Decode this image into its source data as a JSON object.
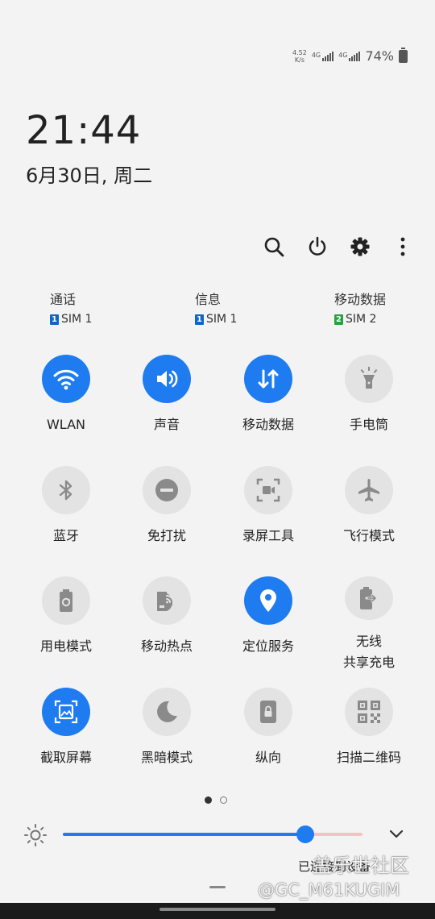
{
  "status_bar": {
    "net_speed_value": "4.52",
    "net_speed_unit": "K/s",
    "sim1_label": "4G",
    "sim2_label": "4G",
    "battery_percent": "74%"
  },
  "clock": {
    "time": "21:44",
    "date": "6月30日, 周二"
  },
  "top_actions": [
    {
      "icon": "search-icon"
    },
    {
      "icon": "power-icon"
    },
    {
      "icon": "gear-icon"
    },
    {
      "icon": "more-vertical-icon"
    }
  ],
  "sim_prefs": [
    {
      "title": "通话",
      "sim_num": "1",
      "sim_name": "SIM 1",
      "color": "#1565c0"
    },
    {
      "title": "信息",
      "sim_num": "1",
      "sim_name": "SIM 1",
      "color": "#1565c0"
    },
    {
      "title": "移动数据",
      "sim_num": "2",
      "sim_name": "SIM 2",
      "color": "#2e9e3f"
    }
  ],
  "tiles": [
    {
      "label": "WLAN",
      "icon": "wifi-icon",
      "on": true
    },
    {
      "label": "声音",
      "icon": "volume-icon",
      "on": true
    },
    {
      "label": "移动数据",
      "icon": "mobile-data-icon",
      "on": true
    },
    {
      "label": "手电筒",
      "icon": "flashlight-icon",
      "on": false
    },
    {
      "label": "蓝牙",
      "icon": "bluetooth-icon",
      "on": false
    },
    {
      "label": "免打扰",
      "icon": "do-not-disturb-icon",
      "on": false
    },
    {
      "label": "录屏工具",
      "icon": "screen-recorder-icon",
      "on": false
    },
    {
      "label": "飞行模式",
      "icon": "airplane-icon",
      "on": false
    },
    {
      "label": "用电模式",
      "icon": "power-mode-icon",
      "on": false
    },
    {
      "label": "移动热点",
      "icon": "hotspot-icon",
      "on": false
    },
    {
      "label": "定位服务",
      "icon": "location-icon",
      "on": true
    },
    {
      "label": "无线\n共享充电",
      "icon": "wireless-powershare-icon",
      "on": false
    },
    {
      "label": "截取屏幕",
      "icon": "screenshot-icon",
      "on": true
    },
    {
      "label": "黑暗模式",
      "icon": "dark-mode-icon",
      "on": false
    },
    {
      "label": "纵向",
      "icon": "portrait-lock-icon",
      "on": false
    },
    {
      "label": "扫描二维码",
      "icon": "qr-scan-icon",
      "on": false
    }
  ],
  "pager": {
    "pages": 2,
    "active": 0
  },
  "brightness": {
    "level": 0.81,
    "icon": "sun-icon",
    "expand_icon": "chevron-down-icon"
  },
  "footer": {
    "text": "已连接到设备"
  },
  "watermark": {
    "line1": "盖乐世社区",
    "line2": "@GC_M61KUGIM"
  },
  "colors": {
    "accent": "#1e7cf0",
    "tile_off": "#e3e3e3",
    "icon_off": "#8a8a8a",
    "background": "#f3f3f3"
  }
}
